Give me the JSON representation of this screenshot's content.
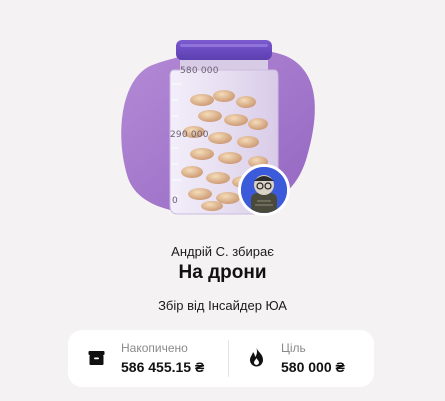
{
  "jar": {
    "scale_top": "580 000",
    "scale_mid": "290 000",
    "scale_bottom": "0",
    "fill_fraction": 1.0
  },
  "collector": "Андрій С. збирає",
  "title": "На дрони",
  "organizer": "Збір від Інсайдер ЮА",
  "stats": {
    "collected_label": "Накопичено",
    "collected_value": "586 455.15 ₴",
    "goal_label": "Ціль",
    "goal_value": "580 000 ₴",
    "collected_icon": "archive-box-icon",
    "goal_icon": "fire-icon"
  },
  "colors": {
    "blob": "#a57acb",
    "jar_lid": "#6d4ec2",
    "jar_glass": "#e9e1f3",
    "accent_avatar": "#3b5bdb"
  }
}
